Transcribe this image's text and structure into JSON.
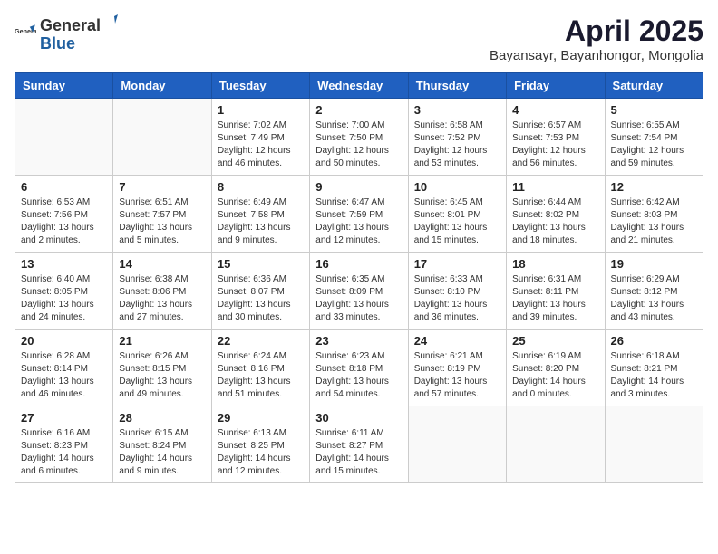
{
  "header": {
    "logo_general": "General",
    "logo_blue": "Blue",
    "month_title": "April 2025",
    "location": "Bayansayr, Bayanhongor, Mongolia"
  },
  "weekdays": [
    "Sunday",
    "Monday",
    "Tuesday",
    "Wednesday",
    "Thursday",
    "Friday",
    "Saturday"
  ],
  "weeks": [
    [
      {
        "day": "",
        "info": ""
      },
      {
        "day": "",
        "info": ""
      },
      {
        "day": "1",
        "info": "Sunrise: 7:02 AM\nSunset: 7:49 PM\nDaylight: 12 hours and 46 minutes."
      },
      {
        "day": "2",
        "info": "Sunrise: 7:00 AM\nSunset: 7:50 PM\nDaylight: 12 hours and 50 minutes."
      },
      {
        "day": "3",
        "info": "Sunrise: 6:58 AM\nSunset: 7:52 PM\nDaylight: 12 hours and 53 minutes."
      },
      {
        "day": "4",
        "info": "Sunrise: 6:57 AM\nSunset: 7:53 PM\nDaylight: 12 hours and 56 minutes."
      },
      {
        "day": "5",
        "info": "Sunrise: 6:55 AM\nSunset: 7:54 PM\nDaylight: 12 hours and 59 minutes."
      }
    ],
    [
      {
        "day": "6",
        "info": "Sunrise: 6:53 AM\nSunset: 7:56 PM\nDaylight: 13 hours and 2 minutes."
      },
      {
        "day": "7",
        "info": "Sunrise: 6:51 AM\nSunset: 7:57 PM\nDaylight: 13 hours and 5 minutes."
      },
      {
        "day": "8",
        "info": "Sunrise: 6:49 AM\nSunset: 7:58 PM\nDaylight: 13 hours and 9 minutes."
      },
      {
        "day": "9",
        "info": "Sunrise: 6:47 AM\nSunset: 7:59 PM\nDaylight: 13 hours and 12 minutes."
      },
      {
        "day": "10",
        "info": "Sunrise: 6:45 AM\nSunset: 8:01 PM\nDaylight: 13 hours and 15 minutes."
      },
      {
        "day": "11",
        "info": "Sunrise: 6:44 AM\nSunset: 8:02 PM\nDaylight: 13 hours and 18 minutes."
      },
      {
        "day": "12",
        "info": "Sunrise: 6:42 AM\nSunset: 8:03 PM\nDaylight: 13 hours and 21 minutes."
      }
    ],
    [
      {
        "day": "13",
        "info": "Sunrise: 6:40 AM\nSunset: 8:05 PM\nDaylight: 13 hours and 24 minutes."
      },
      {
        "day": "14",
        "info": "Sunrise: 6:38 AM\nSunset: 8:06 PM\nDaylight: 13 hours and 27 minutes."
      },
      {
        "day": "15",
        "info": "Sunrise: 6:36 AM\nSunset: 8:07 PM\nDaylight: 13 hours and 30 minutes."
      },
      {
        "day": "16",
        "info": "Sunrise: 6:35 AM\nSunset: 8:09 PM\nDaylight: 13 hours and 33 minutes."
      },
      {
        "day": "17",
        "info": "Sunrise: 6:33 AM\nSunset: 8:10 PM\nDaylight: 13 hours and 36 minutes."
      },
      {
        "day": "18",
        "info": "Sunrise: 6:31 AM\nSunset: 8:11 PM\nDaylight: 13 hours and 39 minutes."
      },
      {
        "day": "19",
        "info": "Sunrise: 6:29 AM\nSunset: 8:12 PM\nDaylight: 13 hours and 43 minutes."
      }
    ],
    [
      {
        "day": "20",
        "info": "Sunrise: 6:28 AM\nSunset: 8:14 PM\nDaylight: 13 hours and 46 minutes."
      },
      {
        "day": "21",
        "info": "Sunrise: 6:26 AM\nSunset: 8:15 PM\nDaylight: 13 hours and 49 minutes."
      },
      {
        "day": "22",
        "info": "Sunrise: 6:24 AM\nSunset: 8:16 PM\nDaylight: 13 hours and 51 minutes."
      },
      {
        "day": "23",
        "info": "Sunrise: 6:23 AM\nSunset: 8:18 PM\nDaylight: 13 hours and 54 minutes."
      },
      {
        "day": "24",
        "info": "Sunrise: 6:21 AM\nSunset: 8:19 PM\nDaylight: 13 hours and 57 minutes."
      },
      {
        "day": "25",
        "info": "Sunrise: 6:19 AM\nSunset: 8:20 PM\nDaylight: 14 hours and 0 minutes."
      },
      {
        "day": "26",
        "info": "Sunrise: 6:18 AM\nSunset: 8:21 PM\nDaylight: 14 hours and 3 minutes."
      }
    ],
    [
      {
        "day": "27",
        "info": "Sunrise: 6:16 AM\nSunset: 8:23 PM\nDaylight: 14 hours and 6 minutes."
      },
      {
        "day": "28",
        "info": "Sunrise: 6:15 AM\nSunset: 8:24 PM\nDaylight: 14 hours and 9 minutes."
      },
      {
        "day": "29",
        "info": "Sunrise: 6:13 AM\nSunset: 8:25 PM\nDaylight: 14 hours and 12 minutes."
      },
      {
        "day": "30",
        "info": "Sunrise: 6:11 AM\nSunset: 8:27 PM\nDaylight: 14 hours and 15 minutes."
      },
      {
        "day": "",
        "info": ""
      },
      {
        "day": "",
        "info": ""
      },
      {
        "day": "",
        "info": ""
      }
    ]
  ]
}
